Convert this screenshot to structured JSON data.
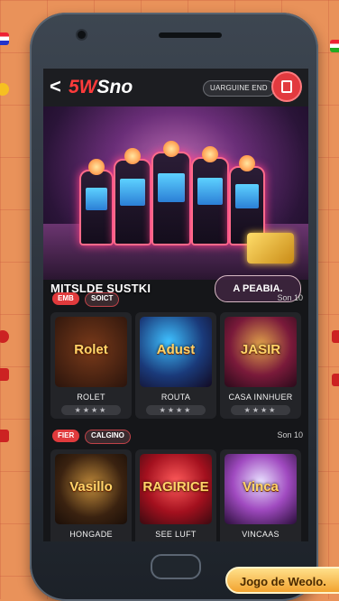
{
  "header": {
    "back_glyph": "<",
    "logo_prefix": "5W",
    "logo_suffix": "Sno",
    "pill_label": "UARGUINE END"
  },
  "banner": {
    "title": "MITSLDE SUSTKI",
    "button_label": "A PEABIA."
  },
  "sections": [
    {
      "tags": [
        "EMB",
        "SOICT"
      ],
      "see_label": "Son 10",
      "games": [
        {
          "thumb_text": "Rolet",
          "name": "ROLET",
          "rating": "★★★★"
        },
        {
          "thumb_text": "Adust",
          "name": "ROUTA",
          "rating": "★★★★"
        },
        {
          "thumb_text": "JASIR",
          "name": "CASA INNHUER",
          "rating": "★★★★"
        }
      ]
    },
    {
      "tags": [
        "FIER",
        "CALGINO"
      ],
      "see_label": "Son 10",
      "games": [
        {
          "thumb_text": "Vasillo",
          "name": "HONGADE",
          "rating": ""
        },
        {
          "thumb_text": "RAGIRICE",
          "name": "SEE LUFT",
          "rating": ""
        },
        {
          "thumb_text": "Vinca",
          "name": "VINCAAS",
          "rating": ""
        }
      ]
    }
  ],
  "cta": {
    "label": "Jogo de Weolo."
  },
  "colors": {
    "accent": "#e03a3c",
    "screen_bg": "#151619",
    "page_bg": "#e9925a"
  }
}
